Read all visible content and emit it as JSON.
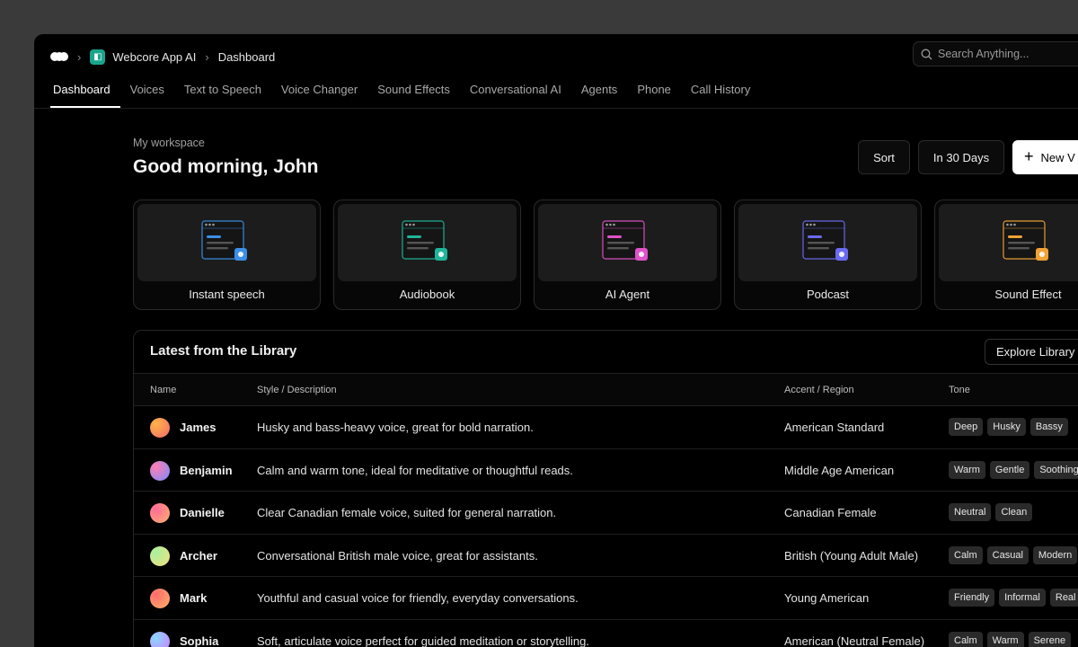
{
  "breadcrumb": {
    "app": "Webcore App AI",
    "page": "Dashboard"
  },
  "search": {
    "placeholder": "Search Anything..."
  },
  "tabs": [
    "Dashboard",
    "Voices",
    "Text to Speech",
    "Voice Changer",
    "Sound Effects",
    "Conversational AI",
    "Agents",
    "Phone",
    "Call History"
  ],
  "header": {
    "kicker": "My workspace",
    "greeting": "Good morning, John"
  },
  "actions": {
    "sort": "Sort",
    "range": "In 30 Days",
    "new": "New V"
  },
  "cards": [
    {
      "label": "Instant speech",
      "accent": "#3b8fe6",
      "icon": "chat-bubble-icon"
    },
    {
      "label": "Audiobook",
      "accent": "#1fb59a",
      "icon": "book-icon"
    },
    {
      "label": "AI Agent",
      "accent": "#e052c7",
      "icon": "sparkle-icon"
    },
    {
      "label": "Podcast",
      "accent": "#6a6af2",
      "icon": "microphone-icon"
    },
    {
      "label": "Sound Effect",
      "accent": "#f0a234",
      "icon": "note-icon"
    }
  ],
  "library": {
    "title": "Latest from the Library",
    "explore": "Explore Library",
    "columns": {
      "name": "Name",
      "style": "Style / Description",
      "accent": "Accent / Region",
      "tone": "Tone"
    },
    "rows": [
      {
        "name": "James",
        "desc": "Husky and bass-heavy voice, great for bold narration.",
        "accent": "American Standard",
        "tones": [
          "Deep",
          "Husky",
          "Bassy"
        ],
        "avatar": [
          "#ffb347",
          "#f26b6b"
        ]
      },
      {
        "name": "Benjamin",
        "desc": "Calm and warm tone, ideal for meditative or thoughtful reads.",
        "accent": "Middle Age American",
        "tones": [
          "Warm",
          "Gentle",
          "Soothing"
        ],
        "avatar": [
          "#ff7eb3",
          "#7b8cff"
        ]
      },
      {
        "name": "Danielle",
        "desc": "Clear Canadian female voice, suited for general narration.",
        "accent": "Canadian Female",
        "tones": [
          "Neutral",
          "Clean"
        ],
        "avatar": [
          "#ff6b9a",
          "#ffb26b"
        ]
      },
      {
        "name": "Archer",
        "desc": "Conversational British male voice, great for assistants.",
        "accent": "British (Young Adult Male)",
        "tones": [
          "Calm",
          "Casual",
          "Modern"
        ],
        "avatar": [
          "#a8f0a0",
          "#f3e07a"
        ]
      },
      {
        "name": "Mark",
        "desc": "Youthful and casual voice for friendly, everyday conversations.",
        "accent": "Young American",
        "tones": [
          "Friendly",
          "Informal",
          "Real"
        ],
        "avatar": [
          "#ff6b6b",
          "#ffb36b"
        ]
      },
      {
        "name": "Sophia",
        "desc": "Soft, articulate voice perfect for guided meditation or storytelling.",
        "accent": "American (Neutral Female)",
        "tones": [
          "Calm",
          "Warm",
          "Serene"
        ],
        "avatar": [
          "#8ad9ff",
          "#d07bff"
        ]
      }
    ]
  }
}
